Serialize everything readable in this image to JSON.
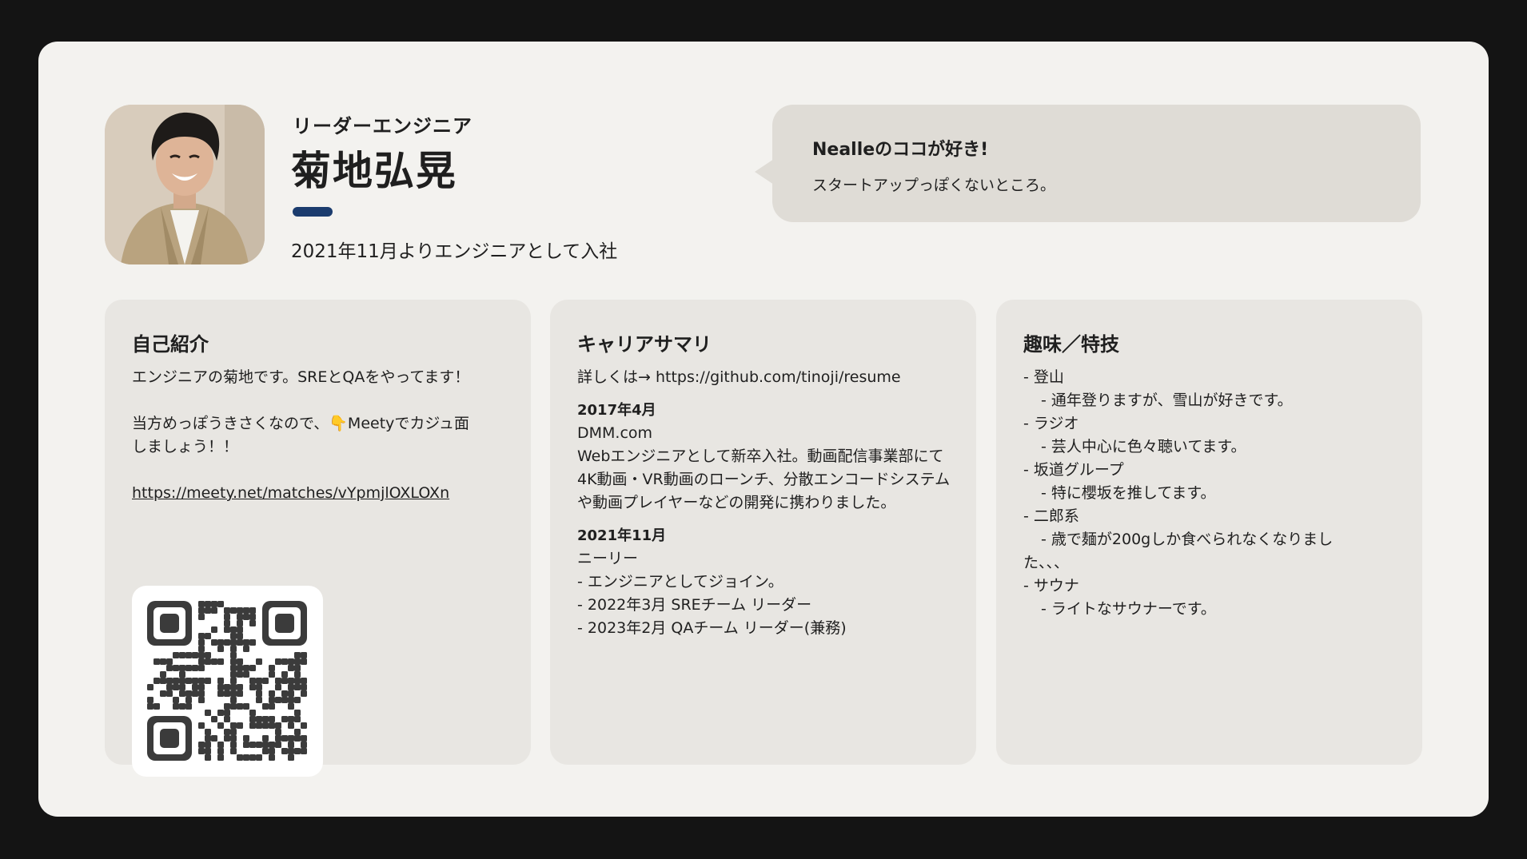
{
  "profile": {
    "role": "リーダーエンジニア",
    "name": "菊地弘晃",
    "joined": "2021年11月よりエンジニアとして入社",
    "accent_color": "#1b3c6e"
  },
  "bubble": {
    "title": "Nealleのココが好き!",
    "text": "スタートアップっぽくないところ。"
  },
  "intro": {
    "title": "自己紹介",
    "line1": "エンジニアの菊地です。SREとQAをやってます！",
    "line2a": "当方めっぽうきさくなので、",
    "line2_icon": "pointing-down-hand-icon",
    "line2b": "Meetyでカジュ面",
    "line3": "しましょう！！",
    "link": "https://meety.net/matches/vYpmjlOXLOXn"
  },
  "career": {
    "title": "キャリアサマリ",
    "resume_prefix": "詳しくは→",
    "resume_link": "https://github.com/tinoji/resume",
    "entries": [
      {
        "date": "2017年4月",
        "company": "DMM.com",
        "lines": [
          " Webエンジニアとして新卒入社。動画配信事業部にて4K動画・VR動画のローンチ、分散エンコードシステムや動画プレイヤーなどの開発に携わりました。"
        ]
      },
      {
        "date": "2021年11月",
        "company": "ニーリー",
        "lines": [
          "- エンジニアとしてジョイン。",
          "- 2022年3月 SREチーム リーダー",
          "- 2023年2月 QAチーム リーダー(兼務)"
        ]
      }
    ]
  },
  "hobbies": {
    "title": "趣味／特技",
    "items": [
      "- 登山",
      "   - 通年登りますが、雪山が好きです。",
      "- ラジオ",
      "   - 芸人中心に色々聴いてます。",
      "- 坂道グループ",
      "   - 特に櫻坂を推してます。",
      "- 二郎系",
      "   - 歳で麺が200gしか食べられなくなりまし",
      "た、、、",
      "- サウナ",
      "   - ライトなサウナーです。"
    ]
  }
}
